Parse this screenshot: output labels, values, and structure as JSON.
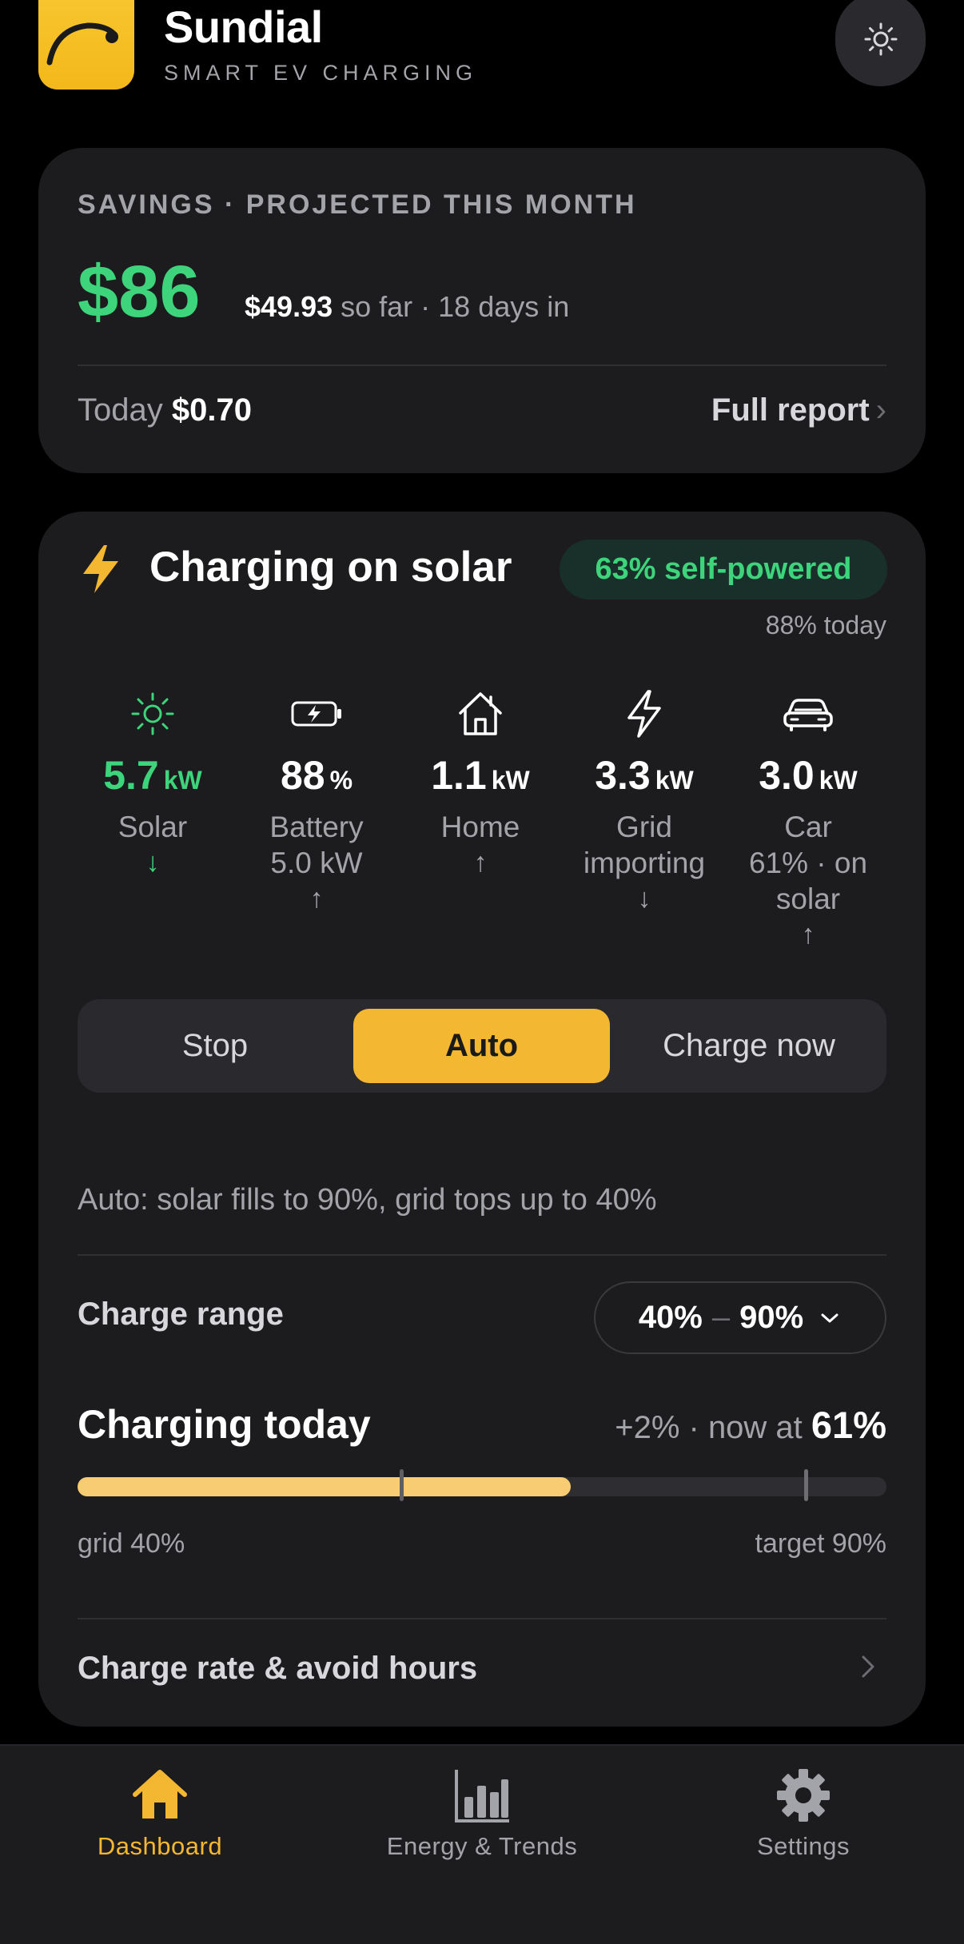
{
  "app": {
    "name": "Sundial",
    "tagline": "SMART EV CHARGING"
  },
  "header": {
    "theme_icon": "sun-icon"
  },
  "savings": {
    "label": "SAVINGS · PROJECTED THIS MONTH",
    "projected": "$86",
    "so_far_amount": "$49.93",
    "so_far_text": "so far · 18 days in",
    "today_label": "Today",
    "today_amount": "$0.70",
    "report_label": "Full report"
  },
  "charging": {
    "title": "Charging on solar",
    "self_powered": "63% self-powered",
    "today_pct": "88% today",
    "flows": [
      {
        "icon": "sun-icon",
        "value": "5.7",
        "unit": "kW",
        "label": "Solar",
        "label2": "",
        "arrow": "↓"
      },
      {
        "icon": "battery-charging-icon",
        "value": "88",
        "unit": "%",
        "label": "Battery",
        "label2": "5.0 kW",
        "arrow": "↑"
      },
      {
        "icon": "house-icon",
        "value": "1.1",
        "unit": "kW",
        "label": "Home",
        "label2": "",
        "arrow": "↑"
      },
      {
        "icon": "bolt-icon",
        "value": "3.3",
        "unit": "kW",
        "label": "Grid",
        "label2": "importing",
        "arrow": "↓"
      },
      {
        "icon": "car-icon",
        "value": "3.0",
        "unit": "kW",
        "label": "Car",
        "label2": "61% · on",
        "label3": "solar",
        "arrow": "↑"
      }
    ],
    "modes": {
      "stop": "Stop",
      "auto": "Auto",
      "now": "Charge now",
      "selected": "auto"
    },
    "auto_desc": "Auto: solar fills to 90%, grid tops up to 40%",
    "range_label": "Charge range",
    "range_min": "40%",
    "range_sep": "–",
    "range_max": "90%",
    "today_title": "Charging today",
    "today_delta": "+2% · now at",
    "today_now": "61%",
    "progress": {
      "now_pct": 61,
      "grid_pct": 40,
      "target_pct": 90
    },
    "grid_label": "grid 40%",
    "target_label": "target 90%",
    "rate_label": "Charge rate & avoid hours"
  },
  "tabs": [
    {
      "label": "Dashboard",
      "icon": "house-icon",
      "active": true
    },
    {
      "label": "Energy & Trends",
      "icon": "bar-chart-icon",
      "active": false
    },
    {
      "label": "Settings",
      "icon": "gear-icon",
      "active": false
    }
  ],
  "colors": {
    "accent": "#f4b731",
    "green": "#3dd47b",
    "card": "#1c1c1f"
  }
}
